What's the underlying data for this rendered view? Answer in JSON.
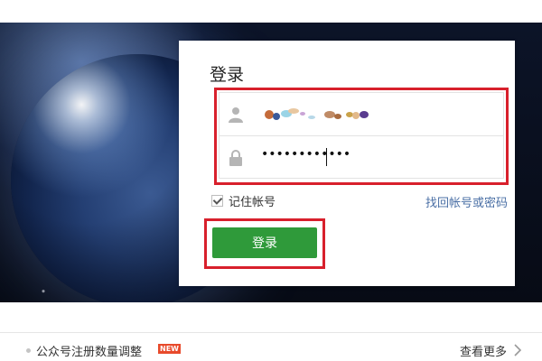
{
  "login": {
    "title": "登录",
    "username_icon": "user-icon",
    "password_icon": "lock-icon",
    "password_value": "••••••••••••",
    "remember_label": "记住帐号",
    "remember_checked": true,
    "recover_link": "找回帐号或密码",
    "submit_label": "登录",
    "submit_color": "#2f9a3a",
    "highlight_color": "#d8202c"
  },
  "footer": {
    "notice": "公众号注册数量调整",
    "badge": "NEW",
    "more_label": "查看更多",
    "more_icon": "chevron-right-icon"
  }
}
